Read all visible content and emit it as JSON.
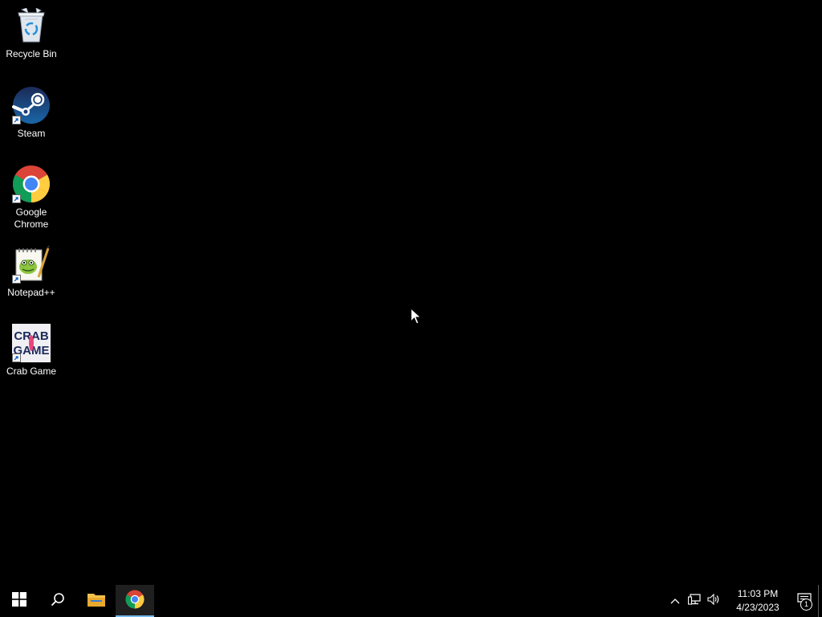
{
  "desktop": {
    "icons": [
      {
        "label": "Recycle Bin",
        "icon": "recycle-bin-icon"
      },
      {
        "label": "Steam",
        "icon": "steam-icon",
        "shortcut": true
      },
      {
        "label": "Google Chrome",
        "icon": "chrome-icon",
        "shortcut": true
      },
      {
        "label": "Notepad++",
        "icon": "notepad-plus-plus-icon",
        "shortcut": true
      },
      {
        "label": "Crab Game",
        "icon": "crab-game-icon",
        "shortcut": true,
        "art_text": [
          "CRAB",
          "GAME"
        ]
      }
    ],
    "background_color": "#000000"
  },
  "taskbar": {
    "buttons": [
      {
        "name": "start",
        "icon": "windows-logo-icon"
      },
      {
        "name": "search",
        "icon": "search-icon"
      },
      {
        "name": "file-explorer",
        "icon": "folder-icon"
      },
      {
        "name": "chrome",
        "icon": "chrome-icon",
        "active": true
      }
    ],
    "tray": {
      "icons": [
        "chevron-up-icon",
        "network-icon",
        "volume-icon"
      ],
      "time": "11:03 PM",
      "date": "4/23/2023",
      "notification_count": "1"
    },
    "accent_color": "#76b9ed"
  }
}
